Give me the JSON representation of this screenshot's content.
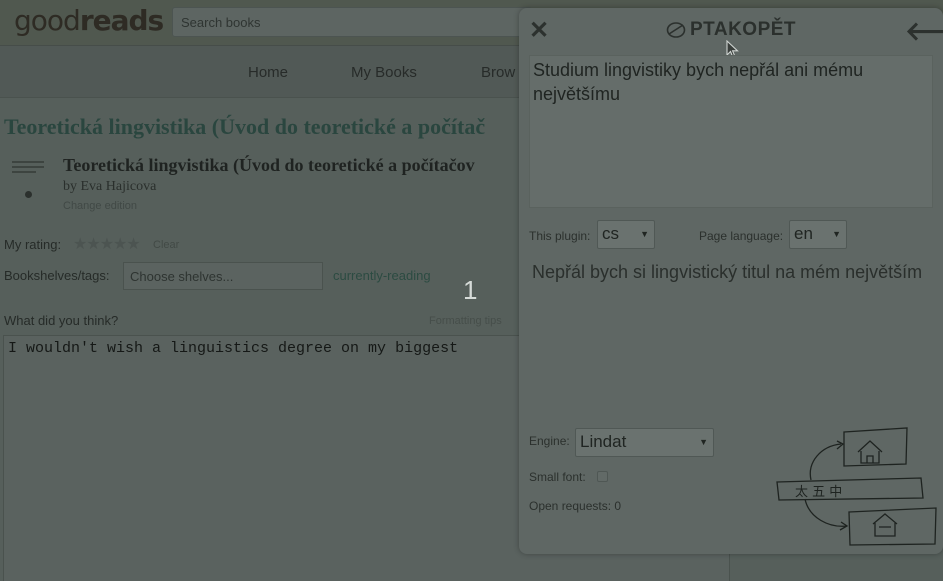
{
  "goodreads": {
    "logo": {
      "light": "good",
      "bold": "reads"
    },
    "search_placeholder": "Search books",
    "nav": [
      "Home",
      "My Books",
      "Brow"
    ],
    "page_title": "Teoretická lingvistika (Úvod do teoretické a počítač",
    "book_title": "Teoretická lingvistika (Úvod do teoretické a počítačov",
    "author": "by Eva Hajicova",
    "change_edition": "Change edition",
    "my_rating_label": "My rating:",
    "clear": "Clear",
    "shelves_label": "Bookshelves/tags:",
    "shelves_placeholder": "Choose shelves...",
    "currently_reading": "currently-reading",
    "what_think": "What did you think?",
    "formatting_tips": "Formatting tips",
    "review_text": "I wouldn't wish a linguistics degree on my biggest",
    "counter": "1"
  },
  "plugin": {
    "close_icon": "close-icon",
    "brand": "PTAKOPĚT",
    "back_icon": "back-arrow-icon",
    "source_text": "Studium lingvistiky bych nepřál ani mému největšímu",
    "plugin_lang_label": "This plugin:",
    "plugin_lang": "cs",
    "page_lang_label": "Page language:",
    "page_lang": "en",
    "back_translation": "Nepřál bych si lingvistický titul na mém největším",
    "engine_label": "Engine:",
    "engine": "Lindat",
    "small_font_label": "Small font:",
    "small_font_checked": false,
    "open_requests": "Open requests: 0",
    "illustration_text": "太 五 中"
  }
}
